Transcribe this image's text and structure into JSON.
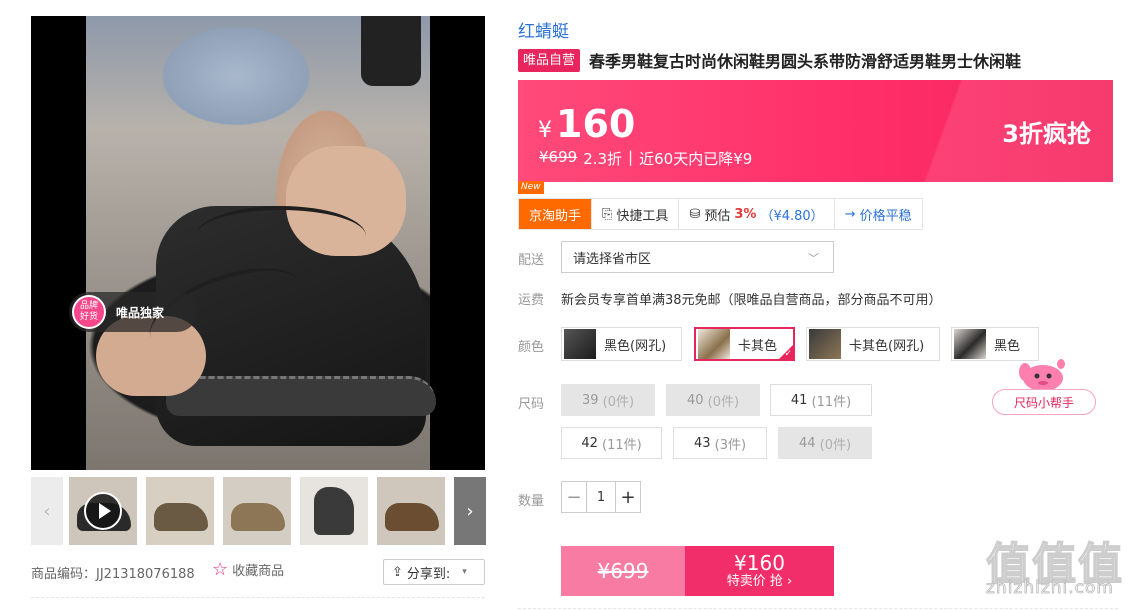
{
  "gallery": {
    "exclusive_badge": {
      "circle_line1": "品牌",
      "circle_line2": "好货",
      "text": "唯品独家"
    },
    "thumbnails": [
      "video",
      "shoe-side",
      "shoe-khaki",
      "shoe-dark-pair",
      "shoe-brown",
      "shoe-partial"
    ],
    "item_code": "商品编码：JJ21318076188",
    "favorite_label": "收藏商品",
    "share_label": "分享到:"
  },
  "product": {
    "brand": "红蜻蜓",
    "self_operated_tag": "唯品自营",
    "title": "春季男鞋复古时尚休闲鞋男圆头系带防滑舒适男鞋男士休闲鞋"
  },
  "price": {
    "symbol": "¥",
    "current": "160",
    "original": "¥699",
    "discount": "2.3折",
    "separator": "|",
    "history": "近60天内已降¥9",
    "promo": "3折疯抢"
  },
  "tools": {
    "new_tag": "New",
    "assistant": "京淘助手",
    "quick_tools": "快捷工具",
    "estimate_label": "预估",
    "estimate_pct": "3%",
    "estimate_amount": "（¥4.80）",
    "price_trend": "价格平稳"
  },
  "delivery": {
    "label": "配送",
    "placeholder": "请选择省市区"
  },
  "shipping": {
    "label": "运费",
    "text": "新会员专享首单满38元免邮（限唯品自营商品，部分商品不可用）"
  },
  "colors": {
    "label": "颜色",
    "options": [
      {
        "name": "黑色(网孔)",
        "selected": false
      },
      {
        "name": "卡其色",
        "selected": true
      },
      {
        "name": "卡其色(网孔)",
        "selected": false
      },
      {
        "name": "黑色",
        "selected": false
      }
    ]
  },
  "sizes": {
    "label": "尺码",
    "options": [
      {
        "size": "39",
        "count": "(0件)",
        "available": false
      },
      {
        "size": "40",
        "count": "(0件)",
        "available": false
      },
      {
        "size": "41",
        "count": "(11件)",
        "available": true
      },
      {
        "size": "42",
        "count": "(11件)",
        "available": true
      },
      {
        "size": "43",
        "count": "(3件)",
        "available": true
      },
      {
        "size": "44",
        "count": "(0件)",
        "available": false
      }
    ],
    "helper": "尺码小帮手"
  },
  "quantity": {
    "label": "数量",
    "minus": "−",
    "value": "1",
    "plus": "+"
  },
  "buy": {
    "original": "¥699",
    "price": "¥160",
    "label": "特卖价 抢 ›"
  },
  "watermark": {
    "chars": "值值值",
    "url": "zhizhizhi.com"
  },
  "colors_theme": {
    "accent_pink": "#f12e6a",
    "brand_blue": "#2b73d9",
    "assistant_orange": "#ff6a00"
  }
}
